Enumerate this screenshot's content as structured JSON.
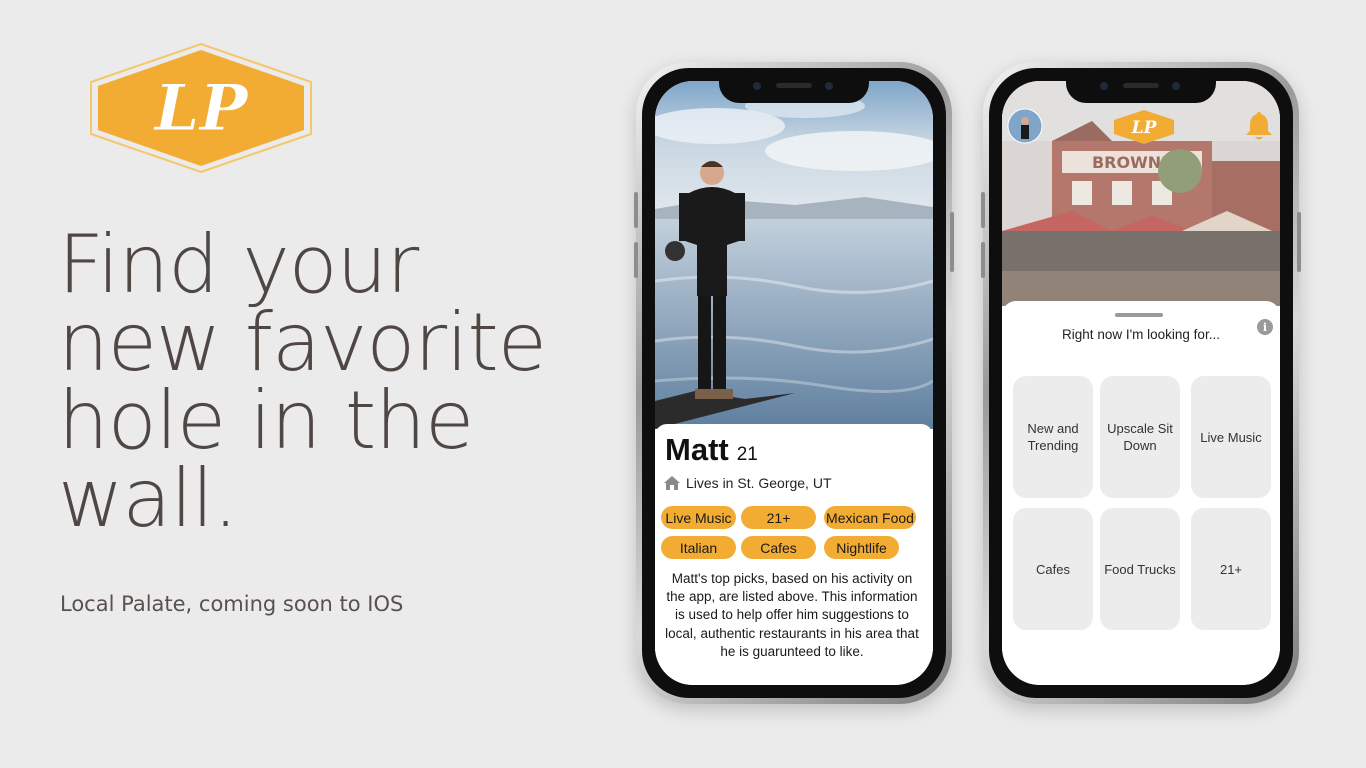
{
  "brand": {
    "logo_text": "LP",
    "accent": "#f2ac34",
    "headline_lines": [
      "Find your",
      "new favorite",
      "hole in the",
      "wall."
    ],
    "tagline": "Local Palate, coming soon to IOS"
  },
  "profile_screen": {
    "name": "Matt",
    "age": "21",
    "location_icon": "home-icon",
    "location": "Lives in St. George, UT",
    "tags": [
      "Live Music",
      "21+",
      "Mexican Food",
      "Italian",
      "Cafes",
      "Nightlife"
    ],
    "bio": "Matt's top picks, based on his activity on the app, are listed above. This information is used to help offer him suggestions to local, authentic restaurants in his area that he is guarunteed to like."
  },
  "home_screen": {
    "header_icons": [
      "avatar",
      "lp-logo-icon",
      "bell-icon"
    ],
    "restaurant_sign": "BROWNE",
    "sheet_title": "Right now I'm looking for...",
    "info_icon": "i",
    "categories": [
      "New and Trending",
      "Upscale Sit Down",
      "Live Music",
      "Cafes",
      "Food Trucks",
      "21+"
    ]
  }
}
